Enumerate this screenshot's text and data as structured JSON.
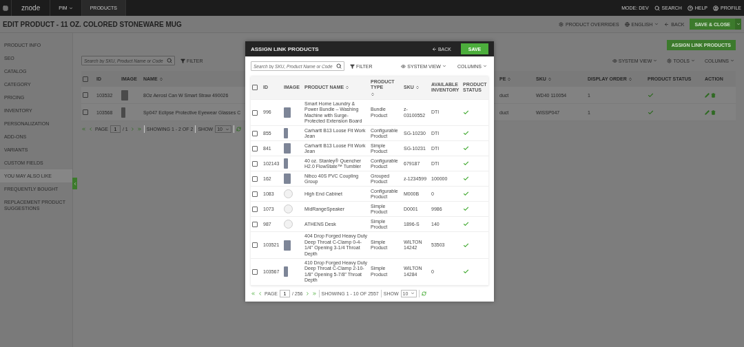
{
  "top_bar": {
    "logo": "znode",
    "nav": [
      {
        "label": "PIM",
        "has_menu": true,
        "selected": false
      },
      {
        "label": "PRODUCTS",
        "has_menu": false,
        "selected": true
      }
    ],
    "right_items": [
      {
        "label": "MODE: DEV",
        "kind": "text"
      },
      {
        "label": "SEARCH",
        "kind": "search"
      },
      {
        "label": "HELP",
        "kind": "help"
      },
      {
        "label": "PROFILE",
        "kind": "profile"
      }
    ]
  },
  "page_header": {
    "title": "EDIT PRODUCT - 11 OZ. COLORED STONEWARE MUG",
    "product_overrides": "PRODUCT OVERRIDES",
    "language": "ENGLISH",
    "back": "BACK",
    "save_close": "SAVE & CLOSE"
  },
  "sidebar": {
    "items": [
      {
        "label": "PRODUCT INFO",
        "selected": false
      },
      {
        "label": "SEO",
        "selected": false
      },
      {
        "label": "CATALOG",
        "selected": false
      },
      {
        "label": "CATEGORY",
        "selected": false
      },
      {
        "label": "PRICING",
        "selected": false
      },
      {
        "label": "INVENTORY",
        "selected": false
      },
      {
        "label": "PERSONALIZATION",
        "selected": false
      },
      {
        "label": "ADD-ONS",
        "selected": false
      },
      {
        "label": "VARIANTS",
        "selected": false
      },
      {
        "label": "CUSTOM FIELDS",
        "selected": false
      },
      {
        "label": "YOU MAY ALSO LIKE",
        "selected": true
      },
      {
        "label": "FREQUENTLY BOUGHT",
        "selected": false
      },
      {
        "label": "REPLACEMENT PRODUCT SUGGESTIONS",
        "selected": false
      }
    ]
  },
  "linked_list": {
    "assign_button": "ASSIGN LINK PRODUCTS",
    "search_placeholder": "Search by SKU, Product Name or Code",
    "filter": "FILTER",
    "system_view": "SYSTEM VIEW",
    "tools": "TOOLS",
    "columns_button": "COLUMNS",
    "select_all_checked": false,
    "columns": [
      {
        "label": "ID",
        "sortable": false
      },
      {
        "label": "IMAGE",
        "sortable": false
      },
      {
        "label": "NAME",
        "sortable": true
      },
      {
        "label": "PE",
        "sortable": true
      },
      {
        "label": "SKU",
        "sortable": true
      },
      {
        "label": "DISPLAY ORDER",
        "sortable": true
      },
      {
        "label": "PRODUCT STATUS",
        "sortable": false
      },
      {
        "label": "ACTION",
        "sortable": false
      }
    ],
    "rows": [
      {
        "kind": "photo",
        "id": "103532",
        "name": "8Oz Aerosl Can W Smart Straw 490026",
        "type": "duct",
        "sku": "WD40 110054",
        "display_order": "1",
        "active": true,
        "checked": false
      },
      {
        "kind": "photo",
        "id": "103568",
        "name": "Sp047 Eclipse Protective Eyewear Glasses C",
        "type": "duct",
        "sku": "WISSP047",
        "display_order": "1",
        "active": true,
        "checked": false
      }
    ],
    "pagination": {
      "page_label": "PAGE",
      "page": "1",
      "of": "/ 1",
      "showing": "SHOWING 1 - 2 OF 2",
      "show_label": "SHOW",
      "show": "10"
    }
  },
  "modal": {
    "title": "ASSIGN LINK PRODUCTS",
    "back": "BACK",
    "save": "SAVE",
    "search_placeholder": "Search by SKU, Product Name or Code",
    "filter": "FILTER",
    "system_view": "SYSTEM VIEW",
    "columns_button": "COLUMNS",
    "select_all_checked": false,
    "columns": [
      {
        "label": "ID",
        "sortable": false
      },
      {
        "label": "IMAGE",
        "sortable": false
      },
      {
        "label": "PRODUCT NAME",
        "sortable": true
      },
      {
        "label": "PRODUCT TYPE",
        "sortable": true
      },
      {
        "label": "SKU",
        "sortable": true
      },
      {
        "label": "AVAILABLE INVENTORY",
        "sortable": false
      },
      {
        "label": "PRODUCT STATUS",
        "sortable": false
      }
    ],
    "rows": [
      {
        "kind": "photo",
        "id": "996",
        "name": "Smart Home Laundry & Power Bundle – Washing Machine with Surge-Protected Extension Board",
        "type": "Bundle Product",
        "sku": "z-03100552",
        "inventory": "DTI",
        "active": true,
        "checked": false
      },
      {
        "kind": "photo",
        "id": "855",
        "name": "Carhartt B13 Loose Fit Work Jean",
        "type": "Configurable Product",
        "sku": "SG-10230",
        "inventory": "DTI",
        "active": true,
        "checked": false
      },
      {
        "kind": "photo",
        "id": "841",
        "name": "Carhartt B13 Loose Fit Work Jean",
        "type": "Simple Product",
        "sku": "SG-10231",
        "inventory": "DTI",
        "active": true,
        "checked": false
      },
      {
        "kind": "photo",
        "id": "102143",
        "name": "40 oz. Stanley® Quencher H2.0 FlowState™ Tumbler",
        "type": "Configurable Product",
        "sku": "679187",
        "inventory": "DTI",
        "active": true,
        "checked": false
      },
      {
        "kind": "photo",
        "id": "162",
        "name": "Nibco 40S PVC Coupling Group",
        "type": "Grouped Product",
        "sku": "z-1234599",
        "inventory": "100000",
        "active": true,
        "checked": false
      },
      {
        "kind": "no_image",
        "id": "1083",
        "name": "High End Cabinet",
        "type": "Configurable Product",
        "sku": "M000B",
        "inventory": "0",
        "active": true,
        "checked": false
      },
      {
        "kind": "no_image",
        "id": "1073",
        "name": "MidRangeSpeaker",
        "type": "Simple Product",
        "sku": "D0001",
        "inventory": "9986",
        "active": true,
        "checked": false
      },
      {
        "kind": "no_image",
        "id": "987",
        "name": "ATHENS Desk",
        "type": "Simple Product",
        "sku": "1896-S",
        "inventory": "140",
        "active": true,
        "checked": false
      },
      {
        "kind": "photo",
        "id": "103521",
        "name": "404 Drop Forged Heavy Duty Deep Throat C-Clamp 0-4-1/4\" Opening 3-1/4 Throat Depth",
        "type": "Simple Product",
        "sku": "WILTON 14242",
        "inventory": "53503",
        "active": true,
        "checked": false
      },
      {
        "kind": "photo",
        "id": "103567",
        "name": "410 Drop Forged Heavy Duty Deep Throat C-Clamp 2-10-1/8\" Opening 5-7/8\" Throat Depth",
        "type": "Simple Product",
        "sku": "WILTON 14284",
        "inventory": "0",
        "active": true,
        "checked": false
      }
    ],
    "pagination": {
      "page_label": "PAGE",
      "page": "1",
      "of": "/ 256",
      "showing": "SHOWING 1 - 10 OF 2557",
      "show_label": "SHOW",
      "show": "10"
    }
  }
}
